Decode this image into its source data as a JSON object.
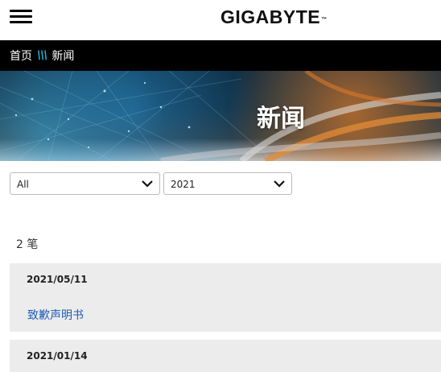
{
  "header": {
    "logo_text": "GIGABYTE",
    "logo_mark": "™"
  },
  "breadcrumb": {
    "home": "首页",
    "separator": "\\\\\\",
    "current": "新闻"
  },
  "banner": {
    "title": "新闻"
  },
  "filters": {
    "category": "All",
    "year": "2021"
  },
  "results": {
    "count_text": "2 笔"
  },
  "news": [
    {
      "date": "2021/05/11",
      "title": "致歉声明书"
    },
    {
      "date": "2021/01/14",
      "title": ""
    }
  ],
  "colors": {
    "link": "#1f5bb5",
    "separator_accent": "#19b5d8",
    "breadcrumb_bg": "#000000",
    "item_bg": "#ececec"
  }
}
